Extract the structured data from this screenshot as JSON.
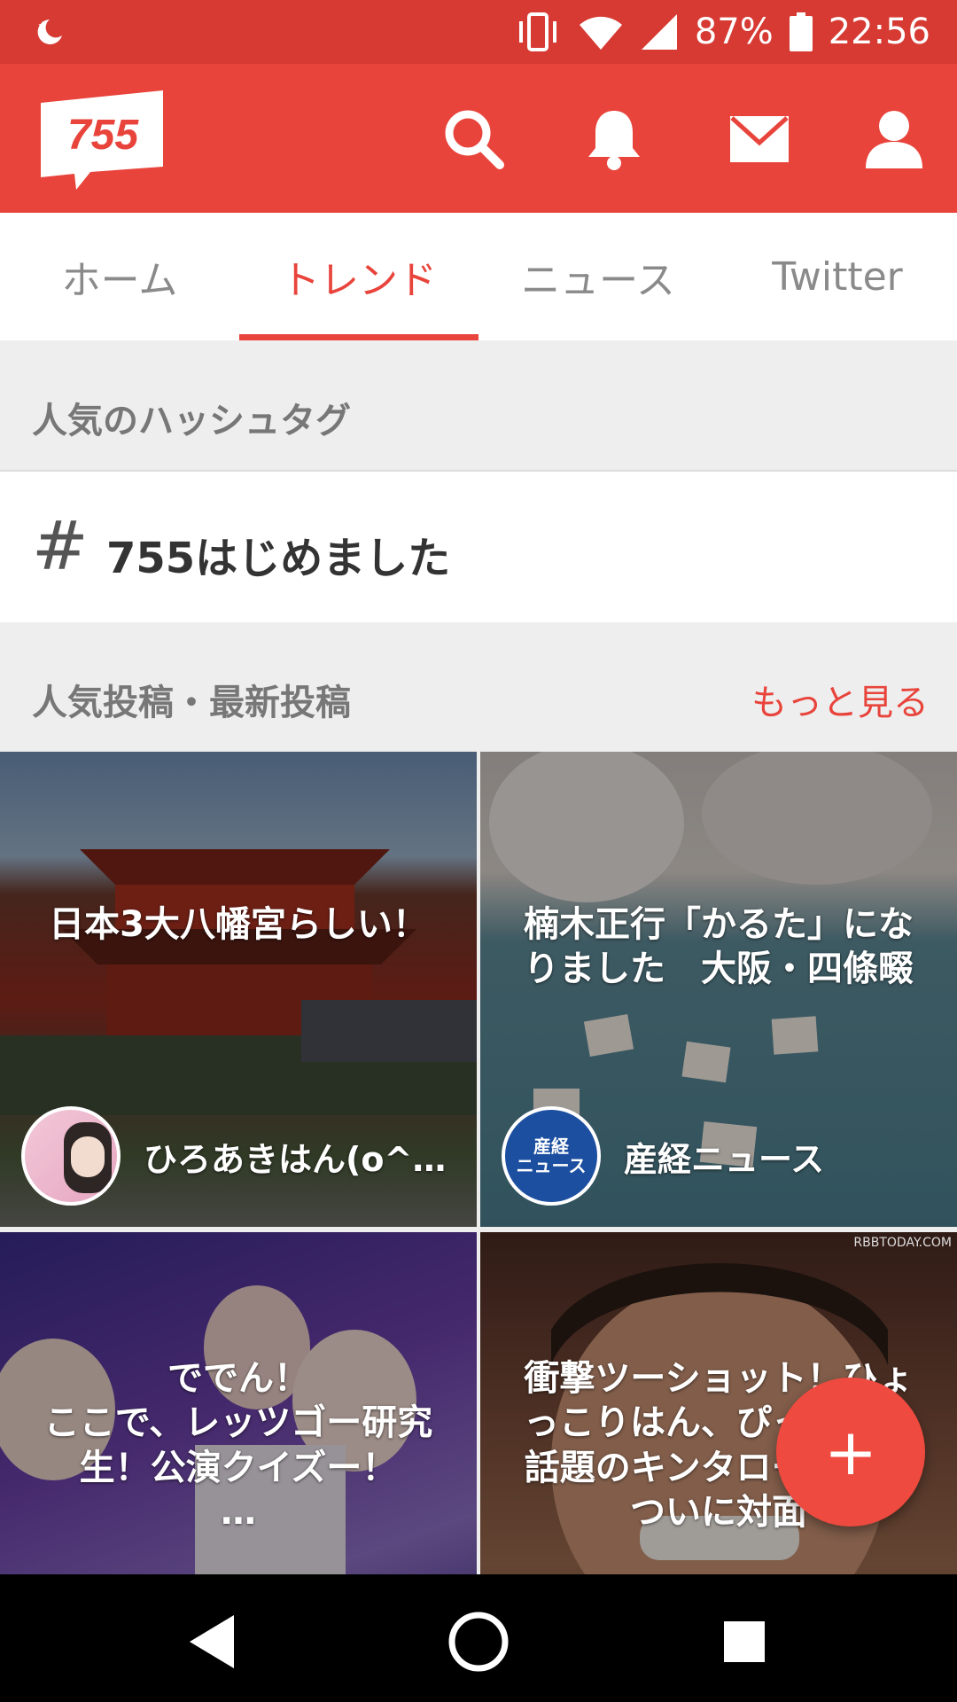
{
  "status_bar": {
    "battery": "87%",
    "time": "22:56",
    "icons": [
      "moon-icon",
      "vibrate-icon",
      "wifi-icon",
      "signal-icon",
      "battery-icon"
    ]
  },
  "app_bar": {
    "logo_text": "755",
    "icons": [
      "search-icon",
      "bell-icon",
      "mail-icon",
      "user-icon"
    ]
  },
  "tabs": [
    {
      "label": "ホーム",
      "active": false
    },
    {
      "label": "トレンド",
      "active": true
    },
    {
      "label": "ニュース",
      "active": false
    },
    {
      "label": "Twitter",
      "active": false
    }
  ],
  "hashtags": {
    "title": "人気のハッシュタグ",
    "items": [
      {
        "symbol": "#",
        "label": "755はじめました"
      }
    ]
  },
  "posts": {
    "title": "人気投稿・最新投稿",
    "more_label": "もっと見る",
    "items": [
      {
        "caption": "日本3大八幡宮らしい！",
        "author": "ひろあきはん(o^…"
      },
      {
        "caption": "楠木正行「かるた」になりました　大阪・四條畷",
        "author": "産経ニュース",
        "avatar_text": "産経\nニュース"
      },
      {
        "caption": "ででん！\nここで、レッツゴー研究生！公演クイズー！\n…",
        "author": ""
      },
      {
        "caption": "衝撃ツーショット！ひょっこりはん、ぴったりと話題のキンタロー。原とついに対面",
        "author": "",
        "watermark": "RBBTODAY.COM"
      }
    ]
  },
  "fab_label": "+",
  "colors": {
    "brand": "#e8443b",
    "status_bar": "#d63a33"
  }
}
